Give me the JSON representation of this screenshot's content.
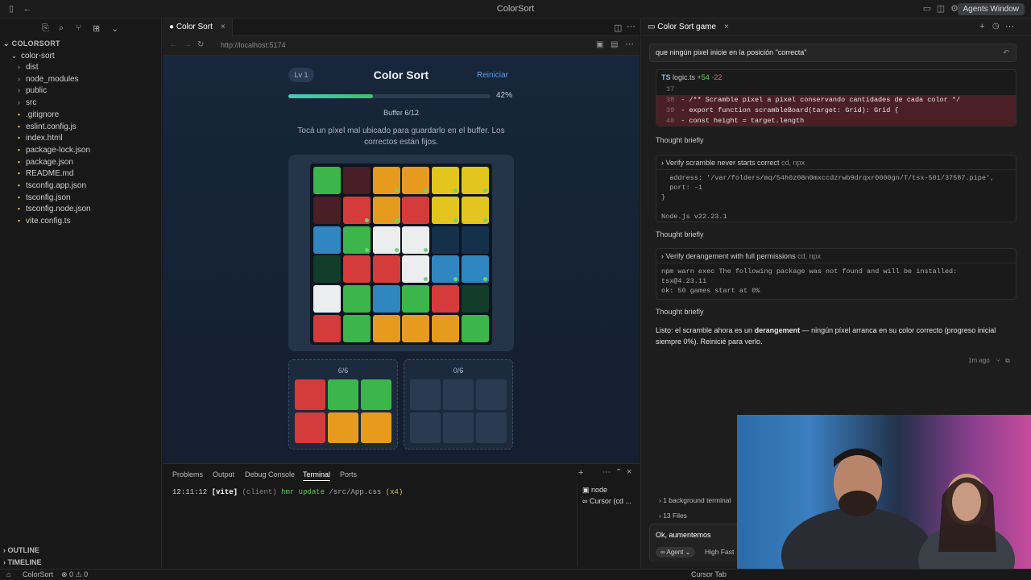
{
  "window": {
    "title": "ColorSort",
    "agents_window_label": "Agents Window"
  },
  "explorer": {
    "root": "COLORSORT",
    "folder": "color-sort",
    "items": [
      {
        "name": "dist",
        "kind": "folder"
      },
      {
        "name": "node_modules",
        "kind": "folder"
      },
      {
        "name": "public",
        "kind": "folder"
      },
      {
        "name": "src",
        "kind": "folder"
      },
      {
        "name": ".gitignore",
        "kind": "file"
      },
      {
        "name": "eslint.config.js",
        "kind": "file"
      },
      {
        "name": "index.html",
        "kind": "file"
      },
      {
        "name": "package-lock.json",
        "kind": "file"
      },
      {
        "name": "package.json",
        "kind": "file"
      },
      {
        "name": "README.md",
        "kind": "file"
      },
      {
        "name": "tsconfig.app.json",
        "kind": "file"
      },
      {
        "name": "tsconfig.json",
        "kind": "file"
      },
      {
        "name": "tsconfig.node.json",
        "kind": "file"
      },
      {
        "name": "vite.config.ts",
        "kind": "file"
      }
    ],
    "outline_label": "OUTLINE",
    "timeline_label": "TIMELINE"
  },
  "editor": {
    "tab_label": "Color Sort",
    "url": "http://localhost:5174"
  },
  "game": {
    "level": "Lv 1",
    "title": "Color Sort",
    "reset_label": "Reiniciar",
    "progress": 0.42,
    "progress_text": "42%",
    "buffer_label": "Buffer 6/12",
    "instructions": "Tocá un píxel mal ubicado para guardarlo en el buffer. Los correctos están fijos.",
    "colors": {
      "g": "#3cb54a",
      "r": "#d63b3b",
      "o": "#e69b1e",
      "y": "#e3c51f",
      "w": "#ecedee",
      "b": "#2f86c0",
      "m": "#4a1e26",
      "n": "#14304a",
      "d": "#133d2b"
    },
    "grid": [
      [
        "g",
        "m",
        "o",
        "o",
        "y",
        "y"
      ],
      [
        "m",
        "r",
        "o",
        "r",
        "y",
        "y"
      ],
      [
        "b",
        "g",
        "w",
        "w",
        "n",
        "n"
      ],
      [
        "d",
        "r",
        "r",
        "w",
        "b",
        "b"
      ],
      [
        "w",
        "g",
        "b",
        "g",
        "r",
        "d"
      ],
      [
        "r",
        "g",
        "o",
        "o",
        "o",
        "g"
      ]
    ],
    "grid_dots": [
      [
        0,
        0,
        1,
        1,
        1,
        1
      ],
      [
        0,
        1,
        1,
        0,
        1,
        1
      ],
      [
        0,
        1,
        1,
        1,
        0,
        0
      ],
      [
        0,
        0,
        0,
        1,
        1,
        1
      ],
      [
        0,
        0,
        0,
        0,
        0,
        0
      ],
      [
        0,
        0,
        0,
        0,
        0,
        0
      ]
    ],
    "bin_left": {
      "label": "6/6",
      "cells": [
        "r",
        "g",
        "g",
        "r",
        "o",
        "o"
      ]
    },
    "bin_right": {
      "label": "0/6",
      "cells": [
        "",
        "",
        "",
        "",
        "",
        ""
      ]
    }
  },
  "panel": {
    "tabs": [
      "Problems",
      "Output",
      "Debug Console",
      "Terminal",
      "Ports"
    ],
    "active_tab": "Terminal",
    "terminal_line": {
      "time": "12:11:12",
      "tag": "[vite]",
      "client": "(client)",
      "msg": "hmr update",
      "path": "/src/App.css",
      "count": "(x4)"
    },
    "terminals": [
      "node",
      "Cursor (cd ..."
    ]
  },
  "chat": {
    "tab_label": "Color Sort game",
    "prompt": "que ningún pixel inicie en la posición \"correcta\"",
    "code": {
      "file": "logic.ts",
      "added": "+54",
      "removed": "-22",
      "lines": [
        {
          "num": "37",
          "text": "",
          "del": false
        },
        {
          "num": "38",
          "text": "- /** Scramble píxel a píxel conservando cantidades de cada color */",
          "del": true
        },
        {
          "num": "39",
          "text": "- export function scrambleBoard(target: Grid): Grid {",
          "del": true
        },
        {
          "num": "40",
          "text": "-   const height = target.length",
          "del": true
        }
      ]
    },
    "thought1": "Thought briefly",
    "tool1": {
      "title": "Verify scramble never starts correct",
      "meta": "cd, npx",
      "body": "  address: '/var/folders/mq/54h0z08n0mxccdzrwb9drqxr0000gn/T/tsx-501/37587.pipe',\n  port: -1\n}\n\nNode.js v22.23.1"
    },
    "thought2": "Thought briefly",
    "tool2": {
      "title": "Verify derangement with full permissions",
      "meta": "cd, npx",
      "body": "npm warn exec The following package was not found and will be installed:\ntsx@4.23.11\nok: 50 games start at 0%"
    },
    "thought3": "Thought briefly",
    "final_pre": "Listo: el scramble ahora es un ",
    "final_bold": "derangement",
    "final_post": " — ningún píxel arranca en su color correcto (progreso inicial siempre 0%). Reinicié para verlo.",
    "time_ago": "1m ago",
    "bg_terminal": "1 background terminal",
    "files": "13 Files",
    "compose_text": "Ok, aumentemos",
    "agent_label": "Agent",
    "model_label": "High Fast"
  },
  "status": {
    "project": "ColorSort",
    "errors": "0",
    "warnings": "0",
    "cursor_tab": "Cursor Tab"
  }
}
